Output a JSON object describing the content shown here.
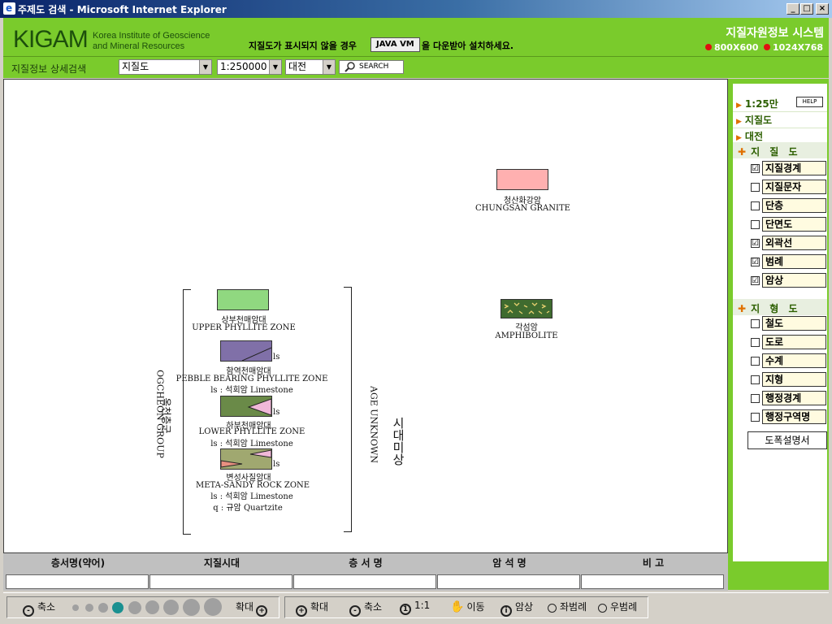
{
  "window": {
    "title": "주제도 검색 - Microsoft Internet Explorer",
    "minimize": "_",
    "maximize": "□",
    "close": "×"
  },
  "header": {
    "logo": "KIGAM",
    "logo_sub_1": "Korea Institute of Geoscience",
    "logo_sub_2": "and Mineral Resources",
    "notice_before": "지질도가 표시되지 않을 경우",
    "java_button": "JAVA VM",
    "notice_after": "을 다운받아 설치하세요.",
    "system_title": "지질자원정보 시스템",
    "res_800": "800X600",
    "res_1024": "1024X768"
  },
  "search": {
    "label": "지질정보 상세검색",
    "map_type": "지질도",
    "scale": "1:250000",
    "region": "대전",
    "button": "SEARCH"
  },
  "legend": {
    "chungsan_ko": "청산화강암",
    "chungsan_en": "CHUNGSAN GRANITE",
    "amphibolite_ko": "각섬암",
    "amphibolite_en": "AMPHIBOLITE",
    "upper_ko": "상부천매암대",
    "upper_en": "UPPER PHYLLITE ZONE",
    "pebble_ko": "함역천매암대",
    "pebble_en": "PEBBLE BEARING PHYLLITE ZONE",
    "pebble_ls": "ls : 석회암 Limestone",
    "lower_ko": "하부천매암대",
    "lower_en": "LOWER PHYLLITE ZONE",
    "lower_ls": "ls : 석회암 Limestone",
    "meta_ko": "변성사질암대",
    "meta_en": "META-SANDY ROCK ZONE",
    "meta_ls": "ls : 석회암 Limestone",
    "meta_q": "q : 규암 Quartzite",
    "ls_tag": "ls",
    "group_ko": "옥천층군",
    "group_en": "OGCHEON GROUP",
    "age_ko": "시대미상",
    "age_en": "AGE UNKNOWN"
  },
  "right_panel": {
    "scale": "1:25만",
    "help": "HELP",
    "map_type": "지질도",
    "region": "대전",
    "section_geology": "지 질 도",
    "geology_items": [
      {
        "label": "지질경계",
        "checked": "☑"
      },
      {
        "label": "지질문자",
        "checked": ""
      },
      {
        "label": "단층",
        "checked": ""
      },
      {
        "label": "단면도",
        "checked": ""
      },
      {
        "label": "외곽선",
        "checked": "☑"
      },
      {
        "label": "범례",
        "checked": "☑"
      },
      {
        "label": "암상",
        "checked": "☑"
      }
    ],
    "section_topo": "지 형 도",
    "topo_items": [
      {
        "label": "철도",
        "checked": ""
      },
      {
        "label": "도로",
        "checked": ""
      },
      {
        "label": "수계",
        "checked": ""
      },
      {
        "label": "지형",
        "checked": ""
      },
      {
        "label": "행정경계",
        "checked": ""
      },
      {
        "label": "행정구역명",
        "checked": ""
      }
    ],
    "doc_button": "도폭설명서"
  },
  "info_table": {
    "headers": [
      "층서명(약어)",
      "지질시대",
      "층 서 명",
      "암 석 명",
      "비 고"
    ]
  },
  "toolbar": {
    "zoom_out": "축소",
    "zoom_in": "확대",
    "btn_zoomin": "확대",
    "btn_zoomout": "축소",
    "btn_11": "1:1",
    "btn_move": "이동",
    "btn_rock": "암상",
    "btn_left_legend": "좌범례",
    "btn_right_legend": "우범례"
  },
  "colors": {
    "header_green": "#7acb2c",
    "chungsan": "#ffb0b0",
    "amphibolite": "#3f6b2f",
    "upper": "#90d880",
    "pebble": "#8070a8",
    "lower": "#6a8a48",
    "meta": "#a0a870"
  }
}
